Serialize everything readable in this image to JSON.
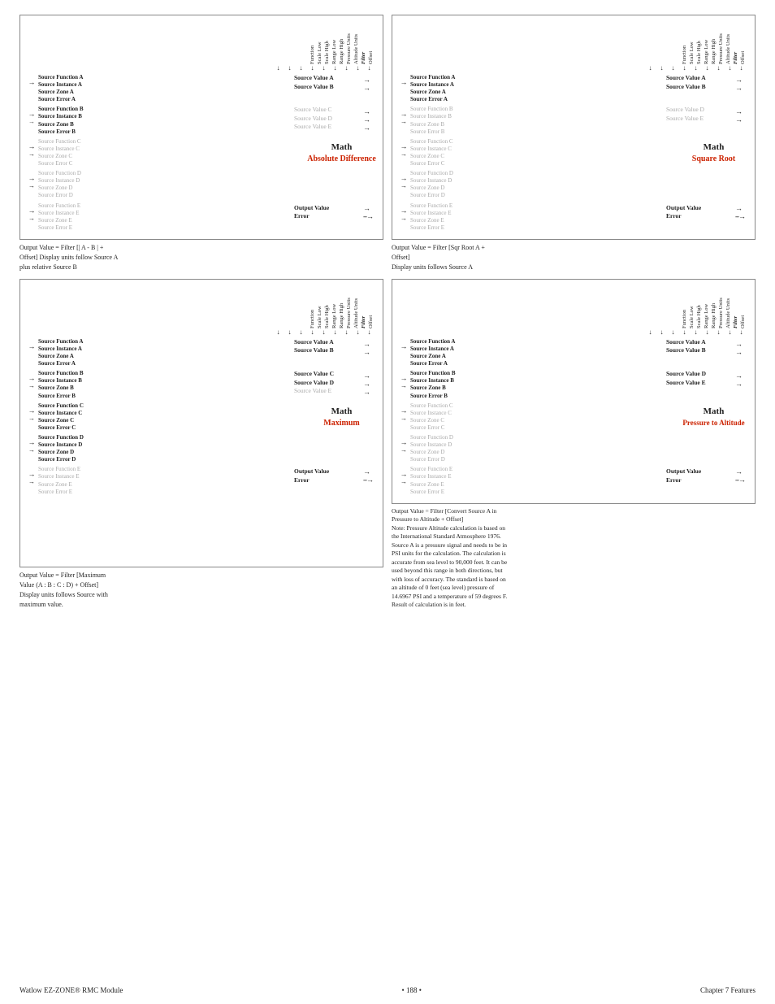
{
  "page": {
    "title": "Watlow EZ-ZONE® RMC Module",
    "page_number": "188",
    "chapter": "Chapter 7 Features"
  },
  "top_left_diagram": {
    "title": "Absolute Difference",
    "header_labels": [
      "Function",
      "Scale Low",
      "Scale High",
      "Range Low",
      "Range High",
      "Pressure Units",
      "Altitude Units",
      "Filter",
      "Offset"
    ],
    "caption": "Output Value = Filter [| A - B | + Offset] Display units follow Source A plus relative Source B",
    "sources": [
      {
        "id": "A",
        "lines": [
          "Source Function A",
          "Source Instance A",
          "Source Zone A",
          "Source Error A"
        ],
        "faded": false,
        "values": [
          "Source Value A",
          "Source Value B"
        ],
        "value_faded": [
          false,
          false
        ]
      },
      {
        "id": "B",
        "lines": [
          "Source Function B",
          "Source Instance B",
          "Source Zone B",
          "Source Error B"
        ],
        "faded": false,
        "values": [
          "Source Value C",
          "Source Value D",
          "Source Value E"
        ],
        "value_faded": [
          true,
          true,
          true
        ]
      },
      {
        "id": "C",
        "lines": [
          "Source Function C",
          "Source Instance C",
          "Source Zone C",
          "Source Error C"
        ],
        "faded": true,
        "values": [],
        "math": "Math",
        "math_sub": "Absolute Difference"
      },
      {
        "id": "D",
        "lines": [
          "Source Function D",
          "Source Instance D",
          "Source Zone D",
          "Source Error D"
        ],
        "faded": true,
        "values": []
      },
      {
        "id": "E",
        "lines": [
          "Source Function E",
          "Source Instance E",
          "Source Zone E",
          "Source Error E"
        ],
        "faded": true,
        "values": [
          "Output Value",
          "Error"
        ],
        "value_faded": [
          false,
          false
        ]
      }
    ]
  },
  "top_right_diagram": {
    "title": "Square Root",
    "header_labels": [
      "Function",
      "Scale Low",
      "Scale High",
      "Range Low",
      "Range High",
      "Pressure Units",
      "Altitude Units",
      "Filter",
      "Offset"
    ],
    "caption": "Output Value = Filter [Sqr Root A + Offset]\nDisplay units follows Source A",
    "sources": [
      {
        "id": "A",
        "lines": [
          "Source Function A",
          "Source Instance A",
          "Source Zone A",
          "Source Error A"
        ],
        "faded": false,
        "values": [
          "Source Value A",
          "Source Value B"
        ],
        "value_faded": [
          false,
          false
        ]
      },
      {
        "id": "B",
        "lines": [
          "Source Function B",
          "Source Instance B",
          "Source Zone B",
          "Source Error B"
        ],
        "faded": true,
        "values": [
          "Source Value D",
          "Source Value E"
        ],
        "value_faded": [
          true,
          true
        ]
      },
      {
        "id": "C",
        "lines": [
          "Source Function C",
          "Source Instance C",
          "Source Zone C",
          "Source Error C"
        ],
        "faded": true,
        "values": [],
        "math": "Math",
        "math_sub": "Square Root"
      },
      {
        "id": "D",
        "lines": [
          "Source Function D",
          "Source Instance D",
          "Source Zone D",
          "Source Error D"
        ],
        "faded": true,
        "values": []
      },
      {
        "id": "E",
        "lines": [
          "Source Function E",
          "Source Instance E",
          "Source Zone E",
          "Source Error E"
        ],
        "faded": true,
        "values": [
          "Output Value",
          "Error"
        ],
        "value_faded": [
          false,
          false
        ]
      }
    ]
  },
  "bottom_left_diagram": {
    "title": "Maximum",
    "header_labels": [
      "Function",
      "Scale Low",
      "Scale High",
      "Range Low",
      "Range High",
      "Pressure Units",
      "Altitude Units",
      "Filter",
      "Offset"
    ],
    "caption": "Output Value = Filter [Maximum Value (A : B : C : D) + Offset] Display units follows Source with maximum value.",
    "sources": [
      {
        "id": "A",
        "lines": [
          "Source Function A",
          "Source Instance A",
          "Source Zone A",
          "Source Error A"
        ],
        "faded": false,
        "values": [
          "Source Value A",
          "Source Value B"
        ],
        "value_faded": [
          false,
          false
        ]
      },
      {
        "id": "B",
        "lines": [
          "Source Function B",
          "Source Instance B",
          "Source Zone B",
          "Source Error B"
        ],
        "faded": false,
        "values": [
          "Source Value C",
          "Source Value D",
          "Source Value E"
        ],
        "value_faded": [
          false,
          false,
          true
        ]
      },
      {
        "id": "C",
        "lines": [
          "Source Function C",
          "Source Instance C",
          "Source Zone C",
          "Source Error C"
        ],
        "faded": false,
        "values": [],
        "math": "Math",
        "math_sub": "Maximum"
      },
      {
        "id": "D",
        "lines": [
          "Source Function D",
          "Source Instance D",
          "Source Zone D",
          "Source Error D"
        ],
        "faded": false,
        "values": []
      },
      {
        "id": "E",
        "lines": [
          "Source Function E",
          "Source Instance E",
          "Source Zone E",
          "Source Error E"
        ],
        "faded": true,
        "values": [
          "Output Value",
          "Error"
        ],
        "value_faded": [
          false,
          false
        ]
      }
    ]
  },
  "bottom_right_diagram": {
    "title": "Pressure to Altitude",
    "header_labels": [
      "Function",
      "Scale Low",
      "Scale High",
      "Range Low",
      "Range High",
      "Pressure Units",
      "Altitude Units",
      "Filter",
      "Offset"
    ],
    "caption": "Output Value = Filter [Convert Source A in Pressure to Altitude + Offset]\nNote: Pressure Altitude calculation is based on the International Standard Atmosphere 1976. Source A is a pressure signal and needs to be in PSI units for the calculation. The calculation is accurate from sea level to 90,000 feet. It can be used beyond this range in both directions, but with loss of accuracy. The standard is based on an altitude of 0 feet (sea level) pressure of 14.6967 PSI and a temperature of 59 degrees F. Result of calculation is in feet.",
    "sources": [
      {
        "id": "A",
        "lines": [
          "Source Function A",
          "Source Instance A",
          "Source Zone A",
          "Source Error A"
        ],
        "faded": false,
        "values": [
          "Source Value A",
          "Source Value B"
        ],
        "value_faded": [
          false,
          false
        ]
      },
      {
        "id": "B",
        "lines": [
          "Source Function B",
          "Source Instance B",
          "Source Zone B",
          "Source Error B"
        ],
        "faded": false,
        "values": [
          "Source Value D",
          "Source Value E"
        ],
        "value_faded": [
          false,
          false
        ]
      },
      {
        "id": "C",
        "lines": [
          "Source Function C",
          "Source Instance C",
          "Source Zone C",
          "Source Error C"
        ],
        "faded": true,
        "values": [],
        "math": "Math",
        "math_sub": "Pressure to Altitude"
      },
      {
        "id": "D",
        "lines": [
          "Source Function D",
          "Source Instance D",
          "Source Zone D",
          "Source Error D"
        ],
        "faded": true,
        "values": []
      },
      {
        "id": "E",
        "lines": [
          "Source Function E",
          "Source Instance E",
          "Source Zone E",
          "Source Error E"
        ],
        "faded": true,
        "values": [
          "Output Value",
          "Error"
        ],
        "value_faded": [
          false,
          false
        ]
      }
    ]
  },
  "labels": {
    "source_value_c_top": "Source Value C",
    "source_value_c_top_faded": true,
    "output_value": "Output Value",
    "error": "Error",
    "math": "Math"
  }
}
